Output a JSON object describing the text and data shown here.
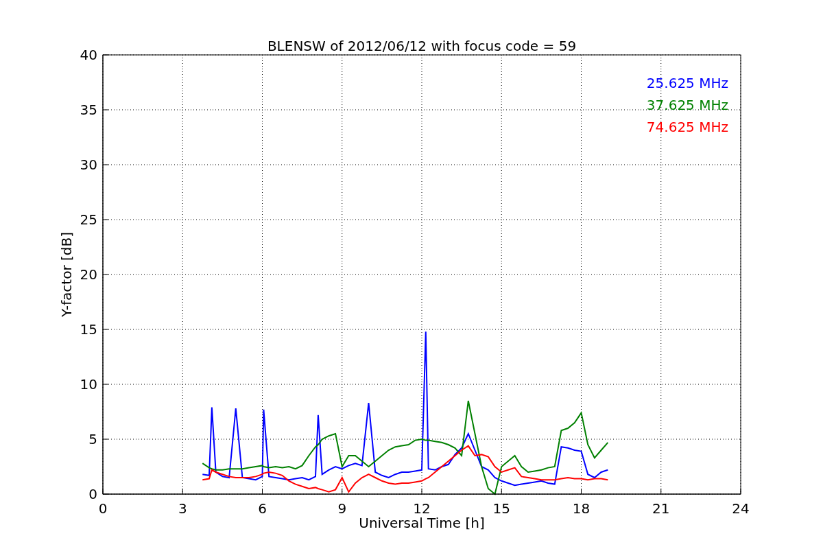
{
  "chart_data": {
    "type": "line",
    "grid": true,
    "title": "BLENSW of 2012/06/12 with focus code = 59",
    "xlabel": "Universal Time [h]",
    "ylabel": "Y-factor [dB]",
    "xlim": [
      0,
      24
    ],
    "ylim": [
      0,
      40
    ],
    "xticks": [
      0,
      3,
      6,
      9,
      12,
      15,
      18,
      21,
      24
    ],
    "yticks": [
      0,
      5,
      10,
      15,
      20,
      25,
      30,
      35,
      40
    ],
    "x": [
      3.75,
      4,
      4.1,
      4.25,
      4.5,
      4.75,
      5,
      5.25,
      5.5,
      5.75,
      6,
      6.05,
      6.25,
      6.5,
      6.75,
      7,
      7.25,
      7.5,
      7.75,
      8,
      8.1,
      8.25,
      8.5,
      8.75,
      9,
      9.25,
      9.5,
      9.75,
      10,
      10.25,
      10.5,
      10.75,
      11,
      11.25,
      11.5,
      11.75,
      12,
      12.15,
      12.25,
      12.5,
      12.75,
      13,
      13.25,
      13.5,
      13.75,
      14,
      14.25,
      14.5,
      14.75,
      15,
      15.25,
      15.5,
      15.75,
      16,
      16.25,
      16.5,
      16.75,
      17,
      17.25,
      17.5,
      17.75,
      18,
      18.25,
      18.5,
      18.75,
      19
    ],
    "series": [
      {
        "name": "25.625 MHz",
        "color": "#0000ff",
        "values": [
          1.8,
          1.7,
          7.9,
          2.0,
          1.6,
          1.5,
          7.8,
          1.5,
          1.4,
          1.3,
          1.6,
          7.7,
          1.6,
          1.5,
          1.4,
          1.3,
          1.4,
          1.5,
          1.3,
          1.6,
          7.2,
          1.8,
          2.2,
          2.5,
          2.3,
          2.6,
          2.8,
          2.6,
          8.3,
          2.0,
          1.7,
          1.5,
          1.8,
          2.0,
          2.0,
          2.1,
          2.2,
          14.8,
          2.3,
          2.2,
          2.5,
          2.7,
          3.6,
          4.2,
          5.5,
          4.0,
          2.5,
          2.2,
          1.5,
          1.2,
          1.0,
          0.8,
          0.9,
          1.0,
          1.1,
          1.2,
          1.0,
          0.9,
          4.3,
          4.2,
          4.0,
          3.9,
          1.8,
          1.5,
          2.0,
          2.2
        ]
      },
      {
        "name": "37.625 MHz",
        "color": "#008000",
        "values": [
          2.8,
          2.4,
          2.3,
          2.2,
          2.2,
          2.3,
          2.3,
          2.3,
          2.4,
          2.5,
          2.6,
          2.5,
          2.4,
          2.5,
          2.4,
          2.5,
          2.3,
          2.6,
          3.5,
          4.3,
          4.5,
          5.0,
          5.3,
          5.5,
          2.5,
          3.5,
          3.5,
          3.0,
          2.5,
          3.0,
          3.5,
          4.0,
          4.3,
          4.4,
          4.5,
          4.9,
          5.0,
          4.9,
          4.9,
          4.8,
          4.7,
          4.5,
          4.2,
          3.5,
          8.5,
          5.5,
          2.5,
          0.5,
          0,
          2.5,
          3.0,
          3.5,
          2.5,
          2.0,
          2.1,
          2.2,
          2.4,
          2.5,
          5.8,
          6.0,
          6.5,
          7.4,
          4.5,
          3.3,
          4.0,
          4.7
        ]
      },
      {
        "name": "74.625 MHz",
        "color": "#ff0000",
        "values": [
          1.3,
          1.4,
          2.2,
          2.0,
          1.8,
          1.6,
          1.5,
          1.5,
          1.5,
          1.6,
          1.8,
          1.9,
          2.0,
          1.9,
          1.7,
          1.2,
          0.9,
          0.7,
          0.5,
          0.6,
          0.5,
          0.4,
          0.2,
          0.4,
          1.5,
          0.2,
          1.0,
          1.5,
          1.8,
          1.5,
          1.2,
          1.0,
          0.9,
          1.0,
          1.0,
          1.1,
          1.2,
          1.4,
          1.5,
          2.0,
          2.5,
          3.0,
          3.5,
          4.0,
          4.4,
          3.5,
          3.6,
          3.4,
          2.5,
          2.0,
          2.2,
          2.4,
          1.6,
          1.5,
          1.4,
          1.3,
          1.3,
          1.3,
          1.4,
          1.5,
          1.4,
          1.4,
          1.3,
          1.4,
          1.4,
          1.3
        ]
      }
    ]
  }
}
